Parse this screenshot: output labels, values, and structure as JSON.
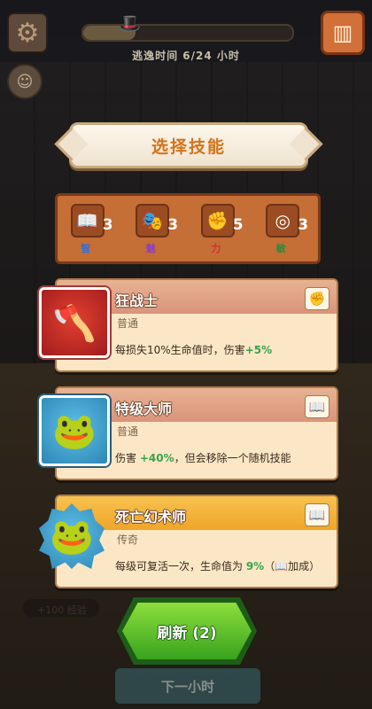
{
  "hud": {
    "timer_text": "逃逸时间 6/24 小时",
    "progress_fraction": 0.25
  },
  "title": "选择技能",
  "stats": [
    {
      "icon": "book-icon",
      "glyph": "📖",
      "value": "3",
      "label": "智",
      "color": "#2e6fd8"
    },
    {
      "icon": "mask-icon",
      "glyph": "🎭",
      "value": "3",
      "label": "魅",
      "color": "#8a3fc0"
    },
    {
      "icon": "fist-icon",
      "glyph": "✊",
      "value": "5",
      "label": "力",
      "color": "#d2332a"
    },
    {
      "icon": "target-icon",
      "glyph": "◎",
      "value": "3",
      "label": "敏",
      "color": "#2f8a3b"
    }
  ],
  "skills": [
    {
      "name": "狂战士",
      "rarity": "普通",
      "desc_prefix": "每损失10%生命值时，伤害",
      "desc_highlight": "+5%",
      "desc_suffix": "",
      "tag_icon": "fist-icon"
    },
    {
      "name": "特级大师",
      "rarity": "普通",
      "desc_prefix": "伤害 ",
      "desc_highlight": "+40%",
      "desc_suffix": "，但会移除一个随机技能",
      "tag_icon": "book-icon"
    },
    {
      "name": "死亡幻术师",
      "rarity": "传奇",
      "desc_prefix": "每级可复活一次，生命值为 ",
      "desc_highlight": "9%",
      "desc_suffix": "（📖加成）",
      "tag_icon": "book-icon"
    }
  ],
  "refresh_label": "刷新 (2)",
  "next_hour_label": "下一小时",
  "background_text": {
    "reward": "+100 经验"
  }
}
